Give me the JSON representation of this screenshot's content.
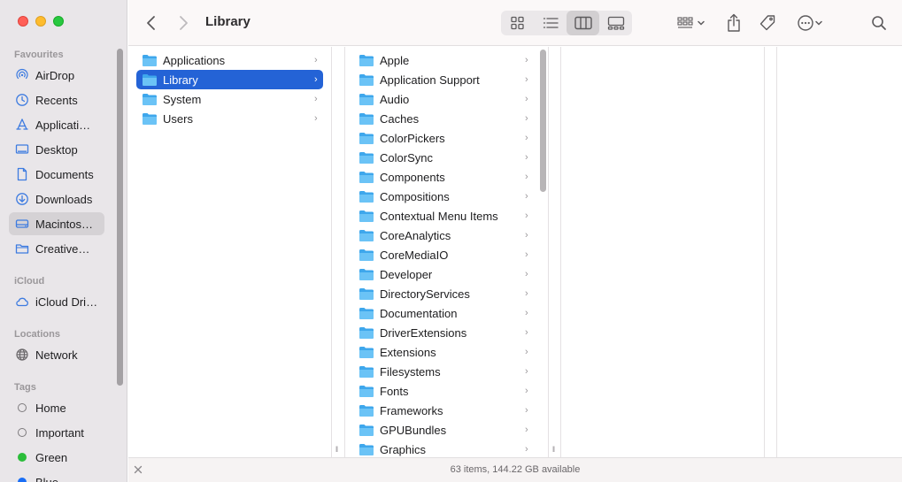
{
  "window": {
    "title": "Library"
  },
  "sidebar": {
    "sections": [
      {
        "label": "Favourites",
        "top": 0
      },
      {
        "label": "iCloud"
      },
      {
        "label": "Locations"
      },
      {
        "label": "Tags"
      }
    ],
    "favourites": [
      {
        "label": "AirDrop",
        "icon": "airdrop-icon"
      },
      {
        "label": "Recents",
        "icon": "clock-icon"
      },
      {
        "label": "Applicati…",
        "icon": "applications-icon"
      },
      {
        "label": "Desktop",
        "icon": "desktop-icon"
      },
      {
        "label": "Documents",
        "icon": "document-icon"
      },
      {
        "label": "Downloads",
        "icon": "download-icon"
      },
      {
        "label": "Macintos…",
        "icon": "disk-icon",
        "selected": true
      },
      {
        "label": "Creative…",
        "icon": "folder-icon"
      }
    ],
    "icloud": [
      {
        "label": "iCloud Dri…",
        "icon": "cloud-icon"
      }
    ],
    "locations": [
      {
        "label": "Network",
        "icon": "network-icon"
      }
    ],
    "tags": [
      {
        "label": "Home",
        "color": ""
      },
      {
        "label": "Important",
        "color": ""
      },
      {
        "label": "Green",
        "color": "#2bbd3a"
      },
      {
        "label": "Blue",
        "color": "#1a6ef5"
      }
    ]
  },
  "column1": {
    "items": [
      {
        "label": "Applications"
      },
      {
        "label": "Library",
        "selected": true
      },
      {
        "label": "System"
      },
      {
        "label": "Users"
      }
    ]
  },
  "column2": {
    "items": [
      "Apple",
      "Application Support",
      "Audio",
      "Caches",
      "ColorPickers",
      "ColorSync",
      "Components",
      "Compositions",
      "Contextual Menu Items",
      "CoreAnalytics",
      "CoreMediaIO",
      "Developer",
      "DirectoryServices",
      "Documentation",
      "DriverExtensions",
      "Extensions",
      "Filesystems",
      "Fonts",
      "Frameworks",
      "GPUBundles",
      "Graphics"
    ]
  },
  "status": {
    "text": "63 items, 144.22 GB available"
  },
  "colors": {
    "accent": "#2463d6",
    "folder": "#5cb7f0"
  }
}
